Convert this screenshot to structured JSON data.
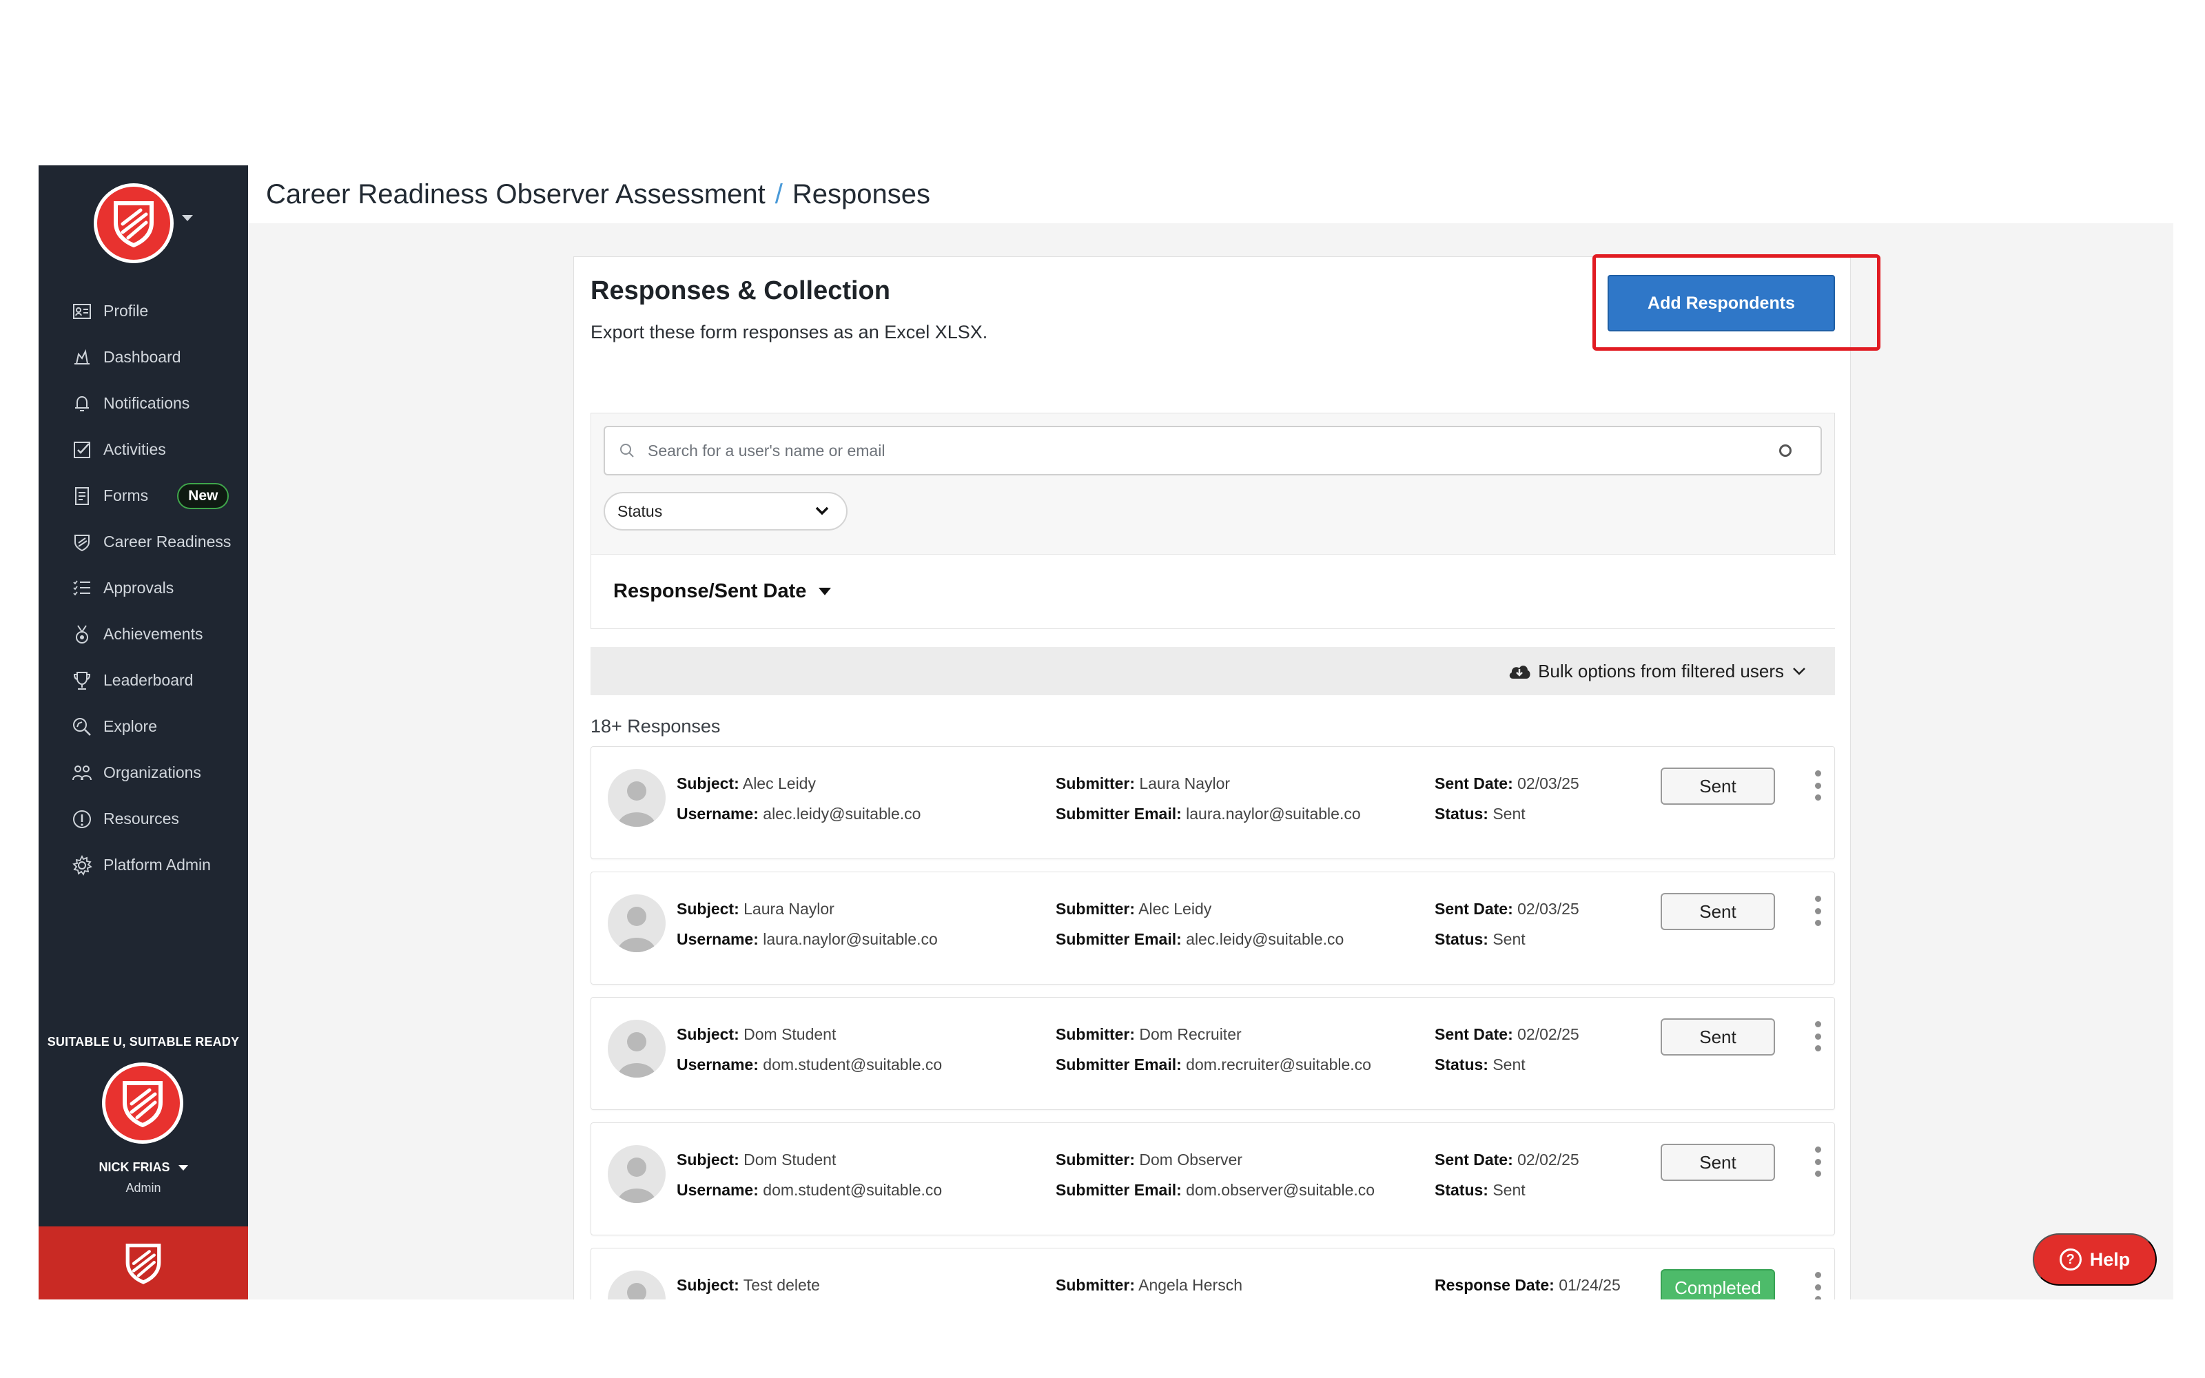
{
  "header": {
    "breadcrumb_parent": "Career Readiness Observer Assessment",
    "breadcrumb_separator": "/",
    "breadcrumb_current": "Responses"
  },
  "sidebar": {
    "items": [
      {
        "label": "Profile",
        "icon": "profile-card-icon"
      },
      {
        "label": "Dashboard",
        "icon": "dashboard-icon"
      },
      {
        "label": "Notifications",
        "icon": "bell-icon"
      },
      {
        "label": "Activities",
        "icon": "checkbox-icon"
      },
      {
        "label": "Forms",
        "icon": "form-icon",
        "badge": "New"
      },
      {
        "label": "Career Readiness",
        "icon": "shield-icon"
      },
      {
        "label": "Approvals",
        "icon": "list-check-icon"
      },
      {
        "label": "Achievements",
        "icon": "medal-icon"
      },
      {
        "label": "Leaderboard",
        "icon": "trophy-icon"
      },
      {
        "label": "Explore",
        "icon": "explore-icon"
      },
      {
        "label": "Organizations",
        "icon": "people-icon"
      },
      {
        "label": "Resources",
        "icon": "info-icon"
      },
      {
        "label": "Platform Admin",
        "icon": "gear-icon"
      }
    ],
    "org_name": "SUITABLE U, SUITABLE READY",
    "user_name": "NICK FRIAS",
    "user_role": "Admin"
  },
  "card": {
    "title": "Responses & Collection",
    "subtitle": "Export these form responses as an Excel XLSX.",
    "add_button": "Add Respondents"
  },
  "filters": {
    "search_placeholder": "Search for a user's name or email",
    "status_label": "Status",
    "sort_label": "Response/Sent Date",
    "bulk_label": "Bulk options from filtered users"
  },
  "responses": {
    "count_label": "18+ Responses",
    "rows": [
      {
        "subject_label": "Subject:",
        "subject": "Alec Leidy",
        "username_label": "Username:",
        "username": "alec.leidy@suitable.co",
        "submitter_label": "Submitter:",
        "submitter": "Laura Naylor",
        "submitter_email_label": "Submitter Email:",
        "submitter_email": "laura.naylor@suitable.co",
        "date_label": "Sent Date:",
        "date": "02/03/25",
        "status_label": "Status:",
        "status": "Sent",
        "pill": "Sent"
      },
      {
        "subject_label": "Subject:",
        "subject": "Laura Naylor",
        "username_label": "Username:",
        "username": "laura.naylor@suitable.co",
        "submitter_label": "Submitter:",
        "submitter": "Alec Leidy",
        "submitter_email_label": "Submitter Email:",
        "submitter_email": "alec.leidy@suitable.co",
        "date_label": "Sent Date:",
        "date": "02/03/25",
        "status_label": "Status:",
        "status": "Sent",
        "pill": "Sent"
      },
      {
        "subject_label": "Subject:",
        "subject": "Dom Student",
        "username_label": "Username:",
        "username": "dom.student@suitable.co",
        "submitter_label": "Submitter:",
        "submitter": "Dom Recruiter",
        "submitter_email_label": "Submitter Email:",
        "submitter_email": "dom.recruiter@suitable.co",
        "date_label": "Sent Date:",
        "date": "02/02/25",
        "status_label": "Status:",
        "status": "Sent",
        "pill": "Sent"
      },
      {
        "subject_label": "Subject:",
        "subject": "Dom Student",
        "username_label": "Username:",
        "username": "dom.student@suitable.co",
        "submitter_label": "Submitter:",
        "submitter": "Dom Observer",
        "submitter_email_label": "Submitter Email:",
        "submitter_email": "dom.observer@suitable.co",
        "date_label": "Sent Date:",
        "date": "02/02/25",
        "status_label": "Status:",
        "status": "Sent",
        "pill": "Sent"
      },
      {
        "subject_label": "Subject:",
        "subject": "Test delete",
        "username_label": "",
        "username": "",
        "submitter_label": "Submitter:",
        "submitter": "Angela Hersch",
        "submitter_email_label": "",
        "submitter_email": "",
        "date_label": "Response Date:",
        "date": "01/24/25",
        "status_label": "",
        "status": "",
        "pill": "Completed"
      }
    ]
  },
  "help": {
    "label": "Help"
  },
  "colors": {
    "sidebar_bg": "#1f2631",
    "brand_red": "#e8322f",
    "primary_blue": "#2f77c8",
    "completed_green": "#4dbb6a",
    "highlight_red": "#e11b22"
  }
}
